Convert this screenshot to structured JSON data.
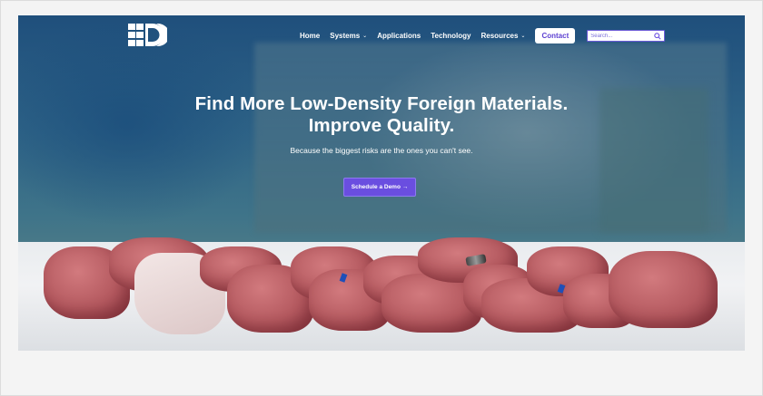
{
  "nav": {
    "items": [
      {
        "label": "Home",
        "dropdown": false
      },
      {
        "label": "Systems",
        "dropdown": true
      },
      {
        "label": "Applications",
        "dropdown": false
      },
      {
        "label": "Technology",
        "dropdown": false
      },
      {
        "label": "Resources",
        "dropdown": true
      }
    ],
    "contact_label": "Contact",
    "search_placeholder": "Search..."
  },
  "hero": {
    "headline_line1": "Find More Low-Density Foreign Materials.",
    "headline_line2": "Improve Quality.",
    "subheadline": "Because the biggest risks are the ones you can't see.",
    "cta_label": "Schedule a Demo →"
  },
  "colors": {
    "accent": "#6a4ee0",
    "contact_text": "#5b3fd1",
    "nav_text": "#ffffff"
  },
  "icons": {
    "logo": "brand-logo",
    "search": "search-icon",
    "chevron": "chevron-down-icon"
  }
}
